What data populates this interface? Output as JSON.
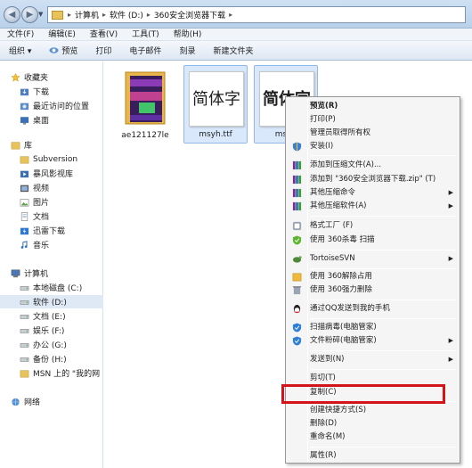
{
  "address": {
    "crumbs": [
      "计算机",
      "软件 (D:)",
      "360安全浏览器下载"
    ]
  },
  "menubar": [
    "文件(F)",
    "编辑(E)",
    "查看(V)",
    "工具(T)",
    "帮助(H)"
  ],
  "toolbar": [
    "组织 ▾",
    "预览",
    "打印",
    "电子邮件",
    "刻录",
    "新建文件夹"
  ],
  "sidebar": [
    {
      "label": "收藏夹",
      "icon": "star-icon",
      "tri": ""
    },
    {
      "label": "下载",
      "icon": "download-folder-icon",
      "tri": ""
    },
    {
      "label": "最近访问的位置",
      "icon": "recent-places-icon",
      "tri": ""
    },
    {
      "label": "桌面",
      "icon": "desktop-icon",
      "tri": ""
    },
    {
      "label": "库",
      "icon": "library-icon",
      "tri": ""
    },
    {
      "label": "Subversion",
      "icon": "folder-icon",
      "tri": ""
    },
    {
      "label": "暴风影视库",
      "icon": "video-library-icon",
      "tri": ""
    },
    {
      "label": "视频",
      "icon": "video-icon",
      "tri": ""
    },
    {
      "label": "图片",
      "icon": "picture-icon",
      "tri": ""
    },
    {
      "label": "文档",
      "icon": "document-icon",
      "tri": ""
    },
    {
      "label": "迅雷下载",
      "icon": "thunder-download-icon",
      "tri": ""
    },
    {
      "label": "音乐",
      "icon": "music-icon",
      "tri": ""
    },
    {
      "label": "计算机",
      "icon": "computer-icon",
      "tri": ""
    },
    {
      "label": "本地磁盘 (C:)",
      "icon": "drive-icon",
      "tri": ""
    },
    {
      "label": "软件 (D:)",
      "icon": "drive-icon",
      "tri": ""
    },
    {
      "label": "文档 (E:)",
      "icon": "drive-icon",
      "tri": ""
    },
    {
      "label": "娱乐 (F:)",
      "icon": "drive-icon",
      "tri": ""
    },
    {
      "label": "办公 (G:)",
      "icon": "drive-icon",
      "tri": ""
    },
    {
      "label": "备份 (H:)",
      "icon": "drive-icon",
      "tri": ""
    },
    {
      "label": "MSN 上的 \"我的网",
      "icon": "msn-folder-icon",
      "tri": ""
    },
    {
      "label": "网络",
      "icon": "network-icon",
      "tri": ""
    }
  ],
  "files": [
    {
      "name": "ae121127le",
      "preview": ""
    },
    {
      "name": "msyh.ttf",
      "preview": "简体字"
    },
    {
      "name": "msyh",
      "preview": "简体字"
    }
  ],
  "context_menu": [
    {
      "label": "预览(R)",
      "icon": "",
      "bold": true,
      "submenu": false
    },
    {
      "label": "打印(P)",
      "icon": "",
      "bold": false,
      "submenu": false
    },
    {
      "label": "管理员取得所有权",
      "icon": "",
      "bold": false,
      "submenu": false
    },
    {
      "label": "安装(I)",
      "icon": "shield-icon",
      "bold": false,
      "submenu": false
    },
    {
      "label": "添加到压缩文件(A)...",
      "icon": "winrar-icon",
      "bold": false,
      "submenu": false
    },
    {
      "label": "添加到 \"360安全浏览器下载.zip\" (T)",
      "icon": "winrar-icon",
      "bold": false,
      "submenu": false
    },
    {
      "label": "其他压缩命令",
      "icon": "winrar-icon",
      "bold": false,
      "submenu": true
    },
    {
      "label": "其他压缩软件(A)",
      "icon": "winrar-icon",
      "bold": false,
      "submenu": true
    },
    {
      "label": "格式工厂 (F)",
      "icon": "format-factory-icon",
      "bold": false,
      "submenu": false
    },
    {
      "label": "使用 360杀毒 扫描",
      "icon": "360-antivirus-icon",
      "bold": false,
      "submenu": false
    },
    {
      "label": "TortoiseSVN",
      "icon": "tortoise-svn-icon",
      "bold": false,
      "submenu": true
    },
    {
      "label": "使用 360解除占用",
      "icon": "360-unlock-icon",
      "bold": false,
      "submenu": false
    },
    {
      "label": "使用 360强力删除",
      "icon": "360-delete-icon",
      "bold": false,
      "submenu": false
    },
    {
      "label": "通过QQ发送到我的手机",
      "icon": "qq-icon",
      "bold": false,
      "submenu": false
    },
    {
      "label": "扫描病毒(电脑管家)",
      "icon": "qq-manager-icon",
      "bold": false,
      "submenu": false
    },
    {
      "label": "文件粉碎(电脑管家)",
      "icon": "qq-manager-icon",
      "bold": false,
      "submenu": true
    },
    {
      "label": "发送到(N)",
      "icon": "",
      "bold": false,
      "submenu": true
    },
    {
      "label": "剪切(T)",
      "icon": "",
      "bold": false,
      "submenu": false
    },
    {
      "label": "复制(C)",
      "icon": "",
      "bold": false,
      "submenu": false
    },
    {
      "label": "创建快捷方式(S)",
      "icon": "",
      "bold": false,
      "submenu": false
    },
    {
      "label": "删除(D)",
      "icon": "",
      "bold": false,
      "submenu": false
    },
    {
      "label": "重命名(M)",
      "icon": "",
      "bold": false,
      "submenu": false
    },
    {
      "label": "属性(R)",
      "icon": "",
      "bold": false,
      "submenu": false
    }
  ],
  "colors": {
    "highlight_border": "#d4141b",
    "selection": "#d9e8fb"
  }
}
